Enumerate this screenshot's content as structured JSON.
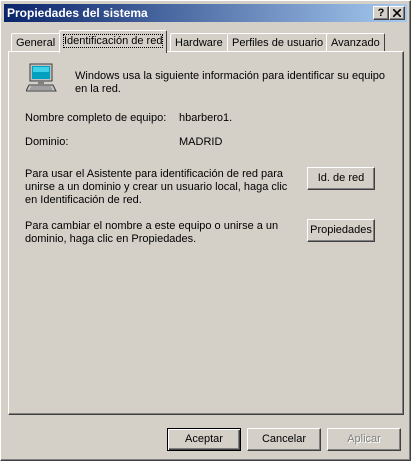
{
  "window": {
    "title": "Propiedades del sistema",
    "help_button": "?",
    "close_button": "✕"
  },
  "tabs": [
    {
      "label": "General"
    },
    {
      "label": "Identificación de red"
    },
    {
      "label": "Hardware"
    },
    {
      "label": "Perfiles de usuario"
    },
    {
      "label": "Avanzado"
    }
  ],
  "active_tab": "Identificación de red",
  "panel": {
    "intro": "Windows usa la siguiente información para identificar su equipo en la red.",
    "computer_name_label": "Nombre completo de equipo:",
    "computer_name_value": "hbarbero1.",
    "domain_label": "Dominio:",
    "domain_value": "MADRID",
    "wizard_text": "Para usar el Asistente para identificación de red para unirse a un dominio y crear un usuario local, haga clic en Identificación de red.",
    "network_id_button": "Id. de red",
    "rename_text": "Para cambiar el nombre a este equipo o unirse a un dominio, haga clic en Propiedades.",
    "properties_button": "Propiedades"
  },
  "footer": {
    "ok": "Aceptar",
    "cancel": "Cancelar",
    "apply": "Aplicar"
  },
  "colors": {
    "title_start": "#0a246a",
    "title_end": "#a6caf0",
    "face": "#d4d0c8"
  }
}
